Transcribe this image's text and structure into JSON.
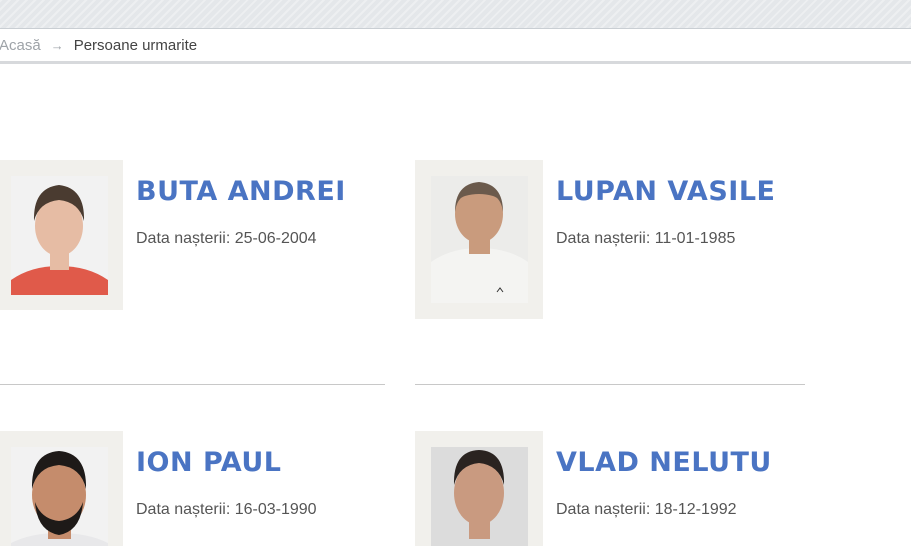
{
  "breadcrumb": {
    "home": "Acasă",
    "separator_icon": "arrow-right-icon",
    "current": "Persoane urmarite"
  },
  "persons": [
    {
      "name": "BUTA ANDREI",
      "dob_label": "Data nașterii: 25-06-2004",
      "shirt_color": "#e05a4a",
      "skin_color": "#e6bca4",
      "hair_color": "#4a3b30",
      "bg_color": "#f2f2f2"
    },
    {
      "name": "LUPAN VASILE",
      "dob_label": "Data nașterii: 11-01-1985",
      "shirt_color": "#f4f4f2",
      "skin_color": "#c99b7d",
      "hair_color": "#6b5a4c",
      "bg_color": "#ececea"
    },
    {
      "name": "ION PAUL",
      "dob_label": "Data nașterii: 16-03-1990",
      "shirt_color": "#e8e8ea",
      "skin_color": "#c58c6c",
      "hair_color": "#1e1a18",
      "bg_color": "#f2f2f2"
    },
    {
      "name": "VLAD NELUTU",
      "dob_label": "Data nașterii: 18-12-1992",
      "shirt_color": "#dcdcdc",
      "skin_color": "#c99a80",
      "hair_color": "#2a2320",
      "bg_color": "#dcdcdc"
    }
  ],
  "colors": {
    "name_accent": "#4a74c3",
    "frame_bg": "#f1f0ec"
  }
}
